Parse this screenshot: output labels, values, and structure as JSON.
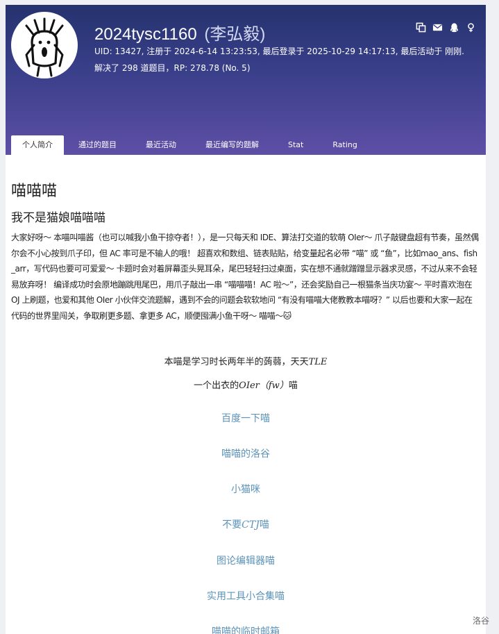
{
  "header": {
    "username": "2024tysc1160",
    "realname": "(李弘毅)",
    "meta_line1": "UID: 13427, 注册于 2024-6-14 13:23:53, 最后登录于 2025-10-29 14:17:13, 最后活动于 刚刚.",
    "meta_line2": "解决了 298 道题目，RP: 278.78 (No. 5)",
    "icons": [
      "copy-icon",
      "mail-icon",
      "qq-icon",
      "gender-male-icon"
    ]
  },
  "tabs": [
    {
      "label": "个人简介",
      "active": true
    },
    {
      "label": "通过的题目",
      "active": false
    },
    {
      "label": "最近活动",
      "active": false
    },
    {
      "label": "最近编写的题解",
      "active": false
    },
    {
      "label": "Stat",
      "active": false
    },
    {
      "label": "Rating",
      "active": false
    }
  ],
  "profile": {
    "heading": "喵喵喵",
    "subheading": "我不是猫娘喵喵喵",
    "intro": "大家好呀～ 本喵叫喵酱（也可以喊我小鱼干掠夺者！），是一只每天和 IDE、算法打交道的软萌 OIer～ 爪子敲键盘超有节奏，虽然偶尔会不小心按到爪子印，但 AC 率可是不输人的哦！ 超喜欢和数组、链表贴贴，给变量起名必带 “喵” 或 “鱼”，比如mao_ans、fish_arr，写代码也要可可爱爱～ 卡题时会对着屏幕歪头晃耳朵，尾巴轻轻扫过桌面，实在想不通就蹭蹭显示器求灵感，不过从来不会轻易放弃呀！ 编译成功时会原地蹦跳甩尾巴，用爪子敲出一串 “喵喵喵！AC 啦～”，还会奖励自己一根猫条当庆功宴～ 平时喜欢泡在 OJ 上刷题，也爱和其他 OIer 小伙伴交流题解，遇到不会的问题会软软地问 “有没有喵喵大佬教教本喵呀？” 以后也要和大家一起在代码的世界里闯关，争取刷更多题、拿更多 AC，顺便囤满小鱼干呀～ 喵喵～🐱",
    "line1_prefix": "本喵是学习时长两年半的蒟蒻，天天",
    "line1_math": "TLE",
    "line2_prefix": "一个出衣的",
    "line2_math": "OIer（fw）",
    "line2_suffix": "喵",
    "links": [
      {
        "prefix": "百度一下喵",
        "math": "",
        "suffix": ""
      },
      {
        "prefix": "喵喵的洛谷",
        "math": "",
        "suffix": ""
      },
      {
        "prefix": "小猫咪",
        "math": "",
        "suffix": ""
      },
      {
        "prefix": "不要",
        "math": "CTJ",
        "suffix": "喵"
      },
      {
        "prefix": "图论编辑器喵",
        "math": "",
        "suffix": ""
      },
      {
        "prefix": "实用工具小合集喵",
        "math": "",
        "suffix": ""
      },
      {
        "prefix": "喵喵的临时邮箱",
        "math": "",
        "suffix": ""
      }
    ]
  },
  "watermark": "洛谷",
  "colors": {
    "header_top": "#25336e",
    "header_bottom": "#5e4fa6",
    "link": "#5b93b8"
  }
}
